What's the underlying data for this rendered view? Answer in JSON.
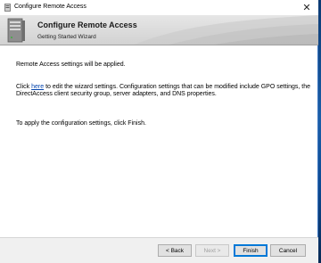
{
  "window": {
    "title": "Configure Remote Access",
    "close_glyph": "✕"
  },
  "banner": {
    "title": "Configure Remote Access",
    "subtitle": "Getting Started Wizard",
    "icon": "server-icon"
  },
  "content": {
    "line1": "Remote Access settings will be applied.",
    "line2_prefix": "Click ",
    "line2_link": "here",
    "line2_suffix": " to edit the wizard settings. Configuration settings that can be modified include GPO settings, the DirectAccess client security group, server adapters, and DNS properties.",
    "line3": "To apply the configuration settings, click Finish."
  },
  "buttons": {
    "back": "< Back",
    "next": "Next >",
    "finish": "Finish",
    "cancel": "Cancel"
  },
  "colors": {
    "link": "#0645ad",
    "default_button_border": "#0078d7",
    "banner_gray": "#d9d9d9"
  }
}
